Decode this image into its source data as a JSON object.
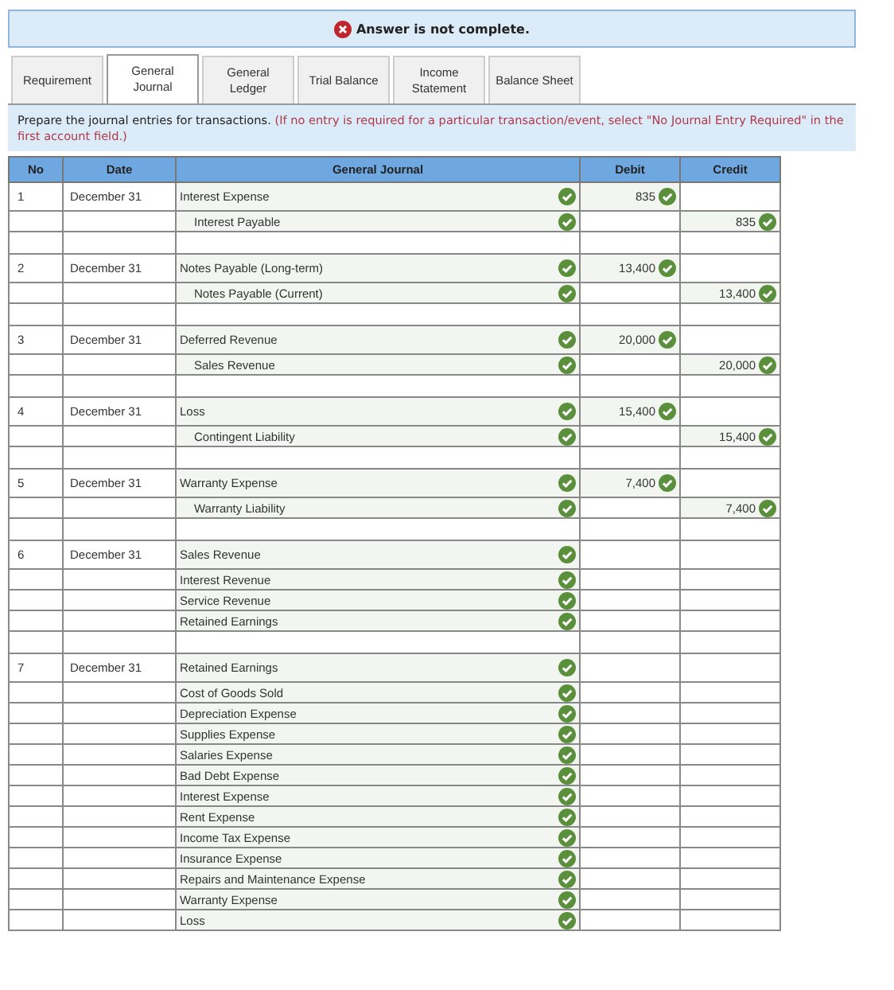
{
  "banner": {
    "text": "Answer is not complete.",
    "complete": false
  },
  "tabs": [
    {
      "label": "Requirement",
      "selected": false
    },
    {
      "label": "General\nJournal",
      "selected": true
    },
    {
      "label": "General\nLedger",
      "selected": false
    },
    {
      "label": "Trial Balance",
      "selected": false
    },
    {
      "label": "Income\nStatement",
      "selected": false
    },
    {
      "label": "Balance Sheet",
      "selected": false
    }
  ],
  "instructions": {
    "text": "Prepare the journal entries for transactions.",
    "note": "(If no entry is required for a particular transaction/event, select \"No Journal Entry Required\" in the first account field.)"
  },
  "table": {
    "columns": [
      "No",
      "Date",
      "General Journal",
      "Debit",
      "Credit"
    ],
    "entries": [
      {
        "no": "1",
        "date": "December 31",
        "lines": [
          {
            "account": "Interest Expense",
            "indented": false,
            "debit": "835",
            "correct": true
          },
          {
            "account": "Interest Payable",
            "indented": true,
            "credit": "835",
            "correct": true
          }
        ]
      },
      {
        "no": "2",
        "date": "December 31",
        "lines": [
          {
            "account": "Notes Payable (Long-term)",
            "indented": false,
            "debit": "13,400",
            "correct": true
          },
          {
            "account": "Notes Payable (Current)",
            "indented": true,
            "credit": "13,400",
            "correct": true
          }
        ]
      },
      {
        "no": "3",
        "date": "December 31",
        "lines": [
          {
            "account": "Deferred Revenue",
            "indented": false,
            "debit": "20,000",
            "correct": true
          },
          {
            "account": "Sales Revenue",
            "indented": true,
            "credit": "20,000",
            "correct": true
          }
        ]
      },
      {
        "no": "4",
        "date": "December 31",
        "lines": [
          {
            "account": "Loss",
            "indented": false,
            "debit": "15,400",
            "correct": true
          },
          {
            "account": "Contingent Liability",
            "indented": true,
            "credit": "15,400",
            "correct": true
          }
        ]
      },
      {
        "no": "5",
        "date": "December 31",
        "lines": [
          {
            "account": "Warranty Expense",
            "indented": false,
            "debit": "7,400",
            "correct": true
          },
          {
            "account": "Warranty Liability",
            "indented": true,
            "credit": "7,400",
            "correct": true
          }
        ]
      },
      {
        "no": "6",
        "date": "December 31",
        "lines": [
          {
            "account": "Sales Revenue",
            "indented": false,
            "correct": true
          },
          {
            "account": "Interest Revenue",
            "indented": false,
            "correct": true
          },
          {
            "account": "Service Revenue",
            "indented": false,
            "correct": true
          },
          {
            "account": "Retained Earnings",
            "indented": false,
            "correct": true
          }
        ]
      },
      {
        "no": "7",
        "date": "December 31",
        "lines": [
          {
            "account": "Retained Earnings",
            "indented": false,
            "correct": true
          },
          {
            "account": "Cost of Goods Sold",
            "indented": false,
            "correct": true
          },
          {
            "account": "Depreciation Expense",
            "indented": false,
            "correct": true
          },
          {
            "account": "Supplies Expense",
            "indented": false,
            "correct": true
          },
          {
            "account": "Salaries Expense",
            "indented": false,
            "correct": true
          },
          {
            "account": "Bad Debt Expense",
            "indented": false,
            "correct": true
          },
          {
            "account": "Interest Expense",
            "indented": false,
            "correct": true
          },
          {
            "account": "Rent Expense",
            "indented": false,
            "correct": true
          },
          {
            "account": "Income Tax Expense",
            "indented": false,
            "correct": true
          },
          {
            "account": "Insurance Expense",
            "indented": false,
            "correct": true
          },
          {
            "account": "Repairs and Maintenance Expense",
            "indented": false,
            "correct": true
          },
          {
            "account": "Warranty Expense",
            "indented": false,
            "correct": true
          },
          {
            "account": "Loss",
            "indented": false,
            "correct": true
          }
        ]
      }
    ]
  }
}
